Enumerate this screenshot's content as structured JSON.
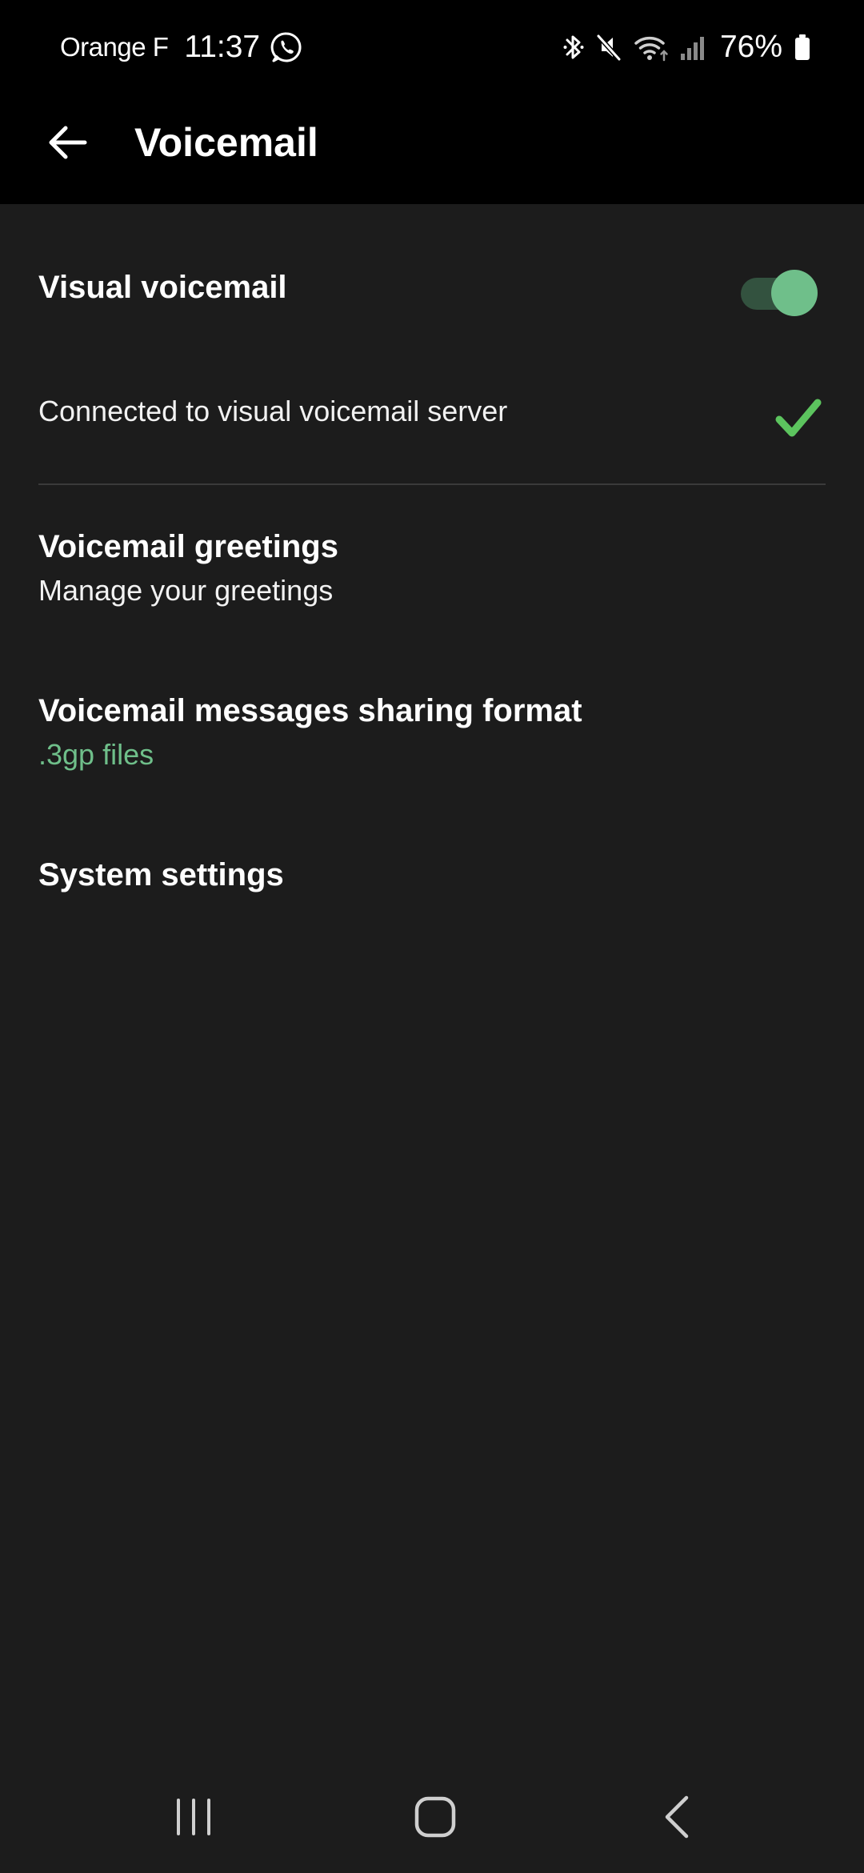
{
  "status_bar": {
    "carrier": "Orange F",
    "time": "11:37",
    "battery_percent": "76%",
    "icons": [
      "whatsapp-icon",
      "bluetooth-icon",
      "mute-icon",
      "wifi-icon",
      "signal-icon",
      "battery-icon"
    ]
  },
  "app_bar": {
    "back_icon": "arrow-left-icon",
    "title": "Voicemail"
  },
  "settings": {
    "visual_voicemail": {
      "label": "Visual voicemail",
      "enabled": true
    },
    "connection_status": {
      "label": "Connected to visual voicemail server",
      "icon": "check-icon"
    },
    "greetings": {
      "title": "Voicemail greetings",
      "subtitle": "Manage your greetings"
    },
    "sharing_format": {
      "title": "Voicemail messages sharing format",
      "value": ".3gp files"
    },
    "system_settings": {
      "title": "System settings"
    }
  },
  "nav_bar": {
    "items": [
      "recents-icon",
      "home-icon",
      "back-icon"
    ]
  },
  "colors": {
    "background": "#1c1c1c",
    "bar_background": "#000000",
    "accent": "#6fbf8a",
    "check": "#5cc45e"
  }
}
